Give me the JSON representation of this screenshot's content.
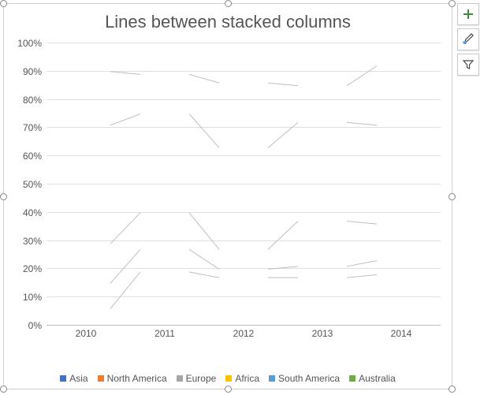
{
  "title": "Lines between stacked columns",
  "legend": [
    {
      "name": "Asia",
      "color": "#4472C4"
    },
    {
      "name": "North America",
      "color": "#ED7D31"
    },
    {
      "name": "Europe",
      "color": "#A5A5A5"
    },
    {
      "name": "Africa",
      "color": "#FFC000"
    },
    {
      "name": "South America",
      "color": "#5B9BD5"
    },
    {
      "name": "Australia",
      "color": "#70AD47"
    }
  ],
  "y_ticks": [
    "0%",
    "10%",
    "20%",
    "30%",
    "40%",
    "50%",
    "60%",
    "70%",
    "80%",
    "90%",
    "100%"
  ],
  "chart_data": {
    "type": "bar",
    "stacked": true,
    "percent": true,
    "title": "Lines between stacked columns",
    "xlabel": "",
    "ylabel": "",
    "ylim": [
      0,
      100
    ],
    "categories": [
      "2010",
      "2011",
      "2012",
      "2013",
      "2014"
    ],
    "series": [
      {
        "name": "Asia",
        "values": [
          6,
          19,
          17,
          17,
          18
        ]
      },
      {
        "name": "North America",
        "values": [
          9,
          8,
          3,
          4,
          5
        ]
      },
      {
        "name": "Europe",
        "values": [
          14,
          13,
          7,
          16,
          13
        ]
      },
      {
        "name": "Africa",
        "values": [
          42,
          35,
          36,
          35,
          35
        ]
      },
      {
        "name": "South America",
        "values": [
          19,
          14,
          23,
          13,
          21
        ]
      },
      {
        "name": "Australia",
        "values": [
          10,
          11,
          14,
          15,
          8
        ]
      }
    ],
    "series_lines": true
  },
  "float_buttons": [
    "chart-elements",
    "chart-styles",
    "chart-filters"
  ]
}
